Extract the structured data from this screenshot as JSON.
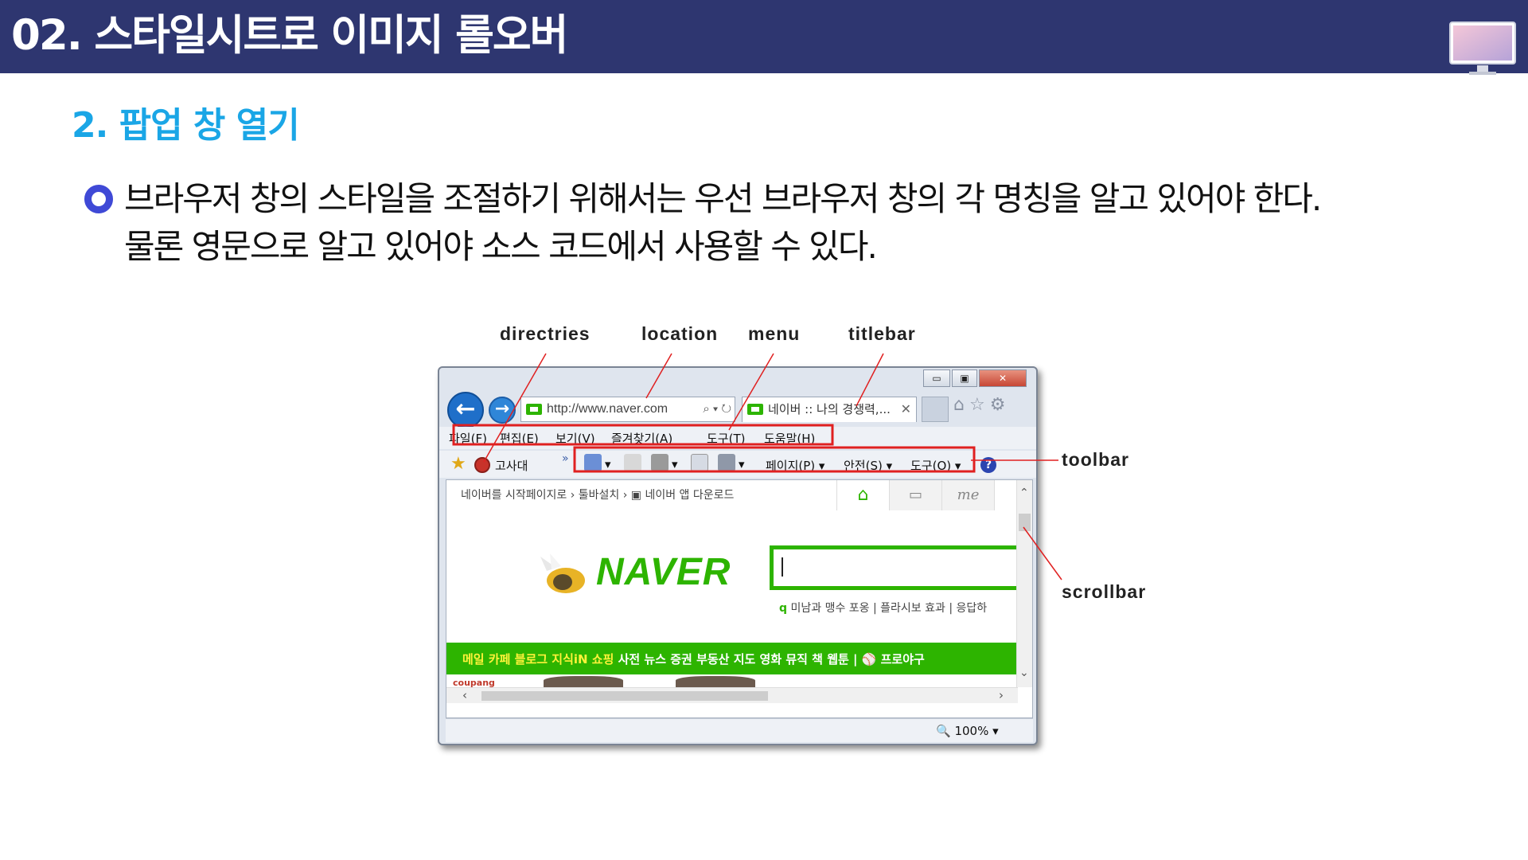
{
  "header": {
    "title": "02. 스타일시트로 이미지 롤오버",
    "icon": "monitor-icon",
    "background": "#2e3670"
  },
  "section": {
    "title": "2. 팝업 창 열기",
    "color": "#1aa6e6"
  },
  "body_text": {
    "bullet_icon": "ring-bullet-icon",
    "bullet_color": "#3f49d6",
    "line1": "브라우저 창의 스타일을 조절하기 위해서는 우선 브라우저 창의 각 명칭을 알고 있어야 한다.",
    "line2": "물론 영문으로 알고 있어야 소스 코드에서 사용할 수 있다."
  },
  "labels": {
    "directries": "directries",
    "location": "location",
    "menu": "menu",
    "titlebar": "titlebar",
    "toolbar": "toolbar",
    "scrollbar": "scrollbar",
    "highlight_color": "#e02020"
  },
  "browser": {
    "window_buttons": {
      "minimize": "▭",
      "maximize": "▣",
      "close": "✕"
    },
    "address": "http://www.naver.com",
    "address_tools": "⌕ ▾ ↻",
    "tab_title": "네이버 :: 나의 경쟁력,...",
    "tab_close": "✕",
    "chrome_icons": "⌂☆⚙",
    "menu_items": [
      "파일(F)",
      "편집(E)",
      "보기(V)",
      "즐겨찾기(A)",
      "도구(T)",
      "도움말(H)"
    ],
    "favorites": {
      "label": "고사대",
      "overflow": "»"
    },
    "toolbar_items": {
      "page": "페이지(P) ▾",
      "safety": "안전(S) ▾",
      "tools": "도구(O) ▾",
      "help": "?"
    },
    "page": {
      "links": "네이버를 시작페이지로 ›   툴바설치 ›   ▣ 네이버 앱 다운로드",
      "tab_home": "⌂",
      "tab_mail": "▭",
      "tab_me": "me",
      "logo": "NAVER",
      "keywords": "미남과 맹수 포옹   |   플라시보 효과   |   응답하",
      "keyword_icon": "q",
      "nav_yellow": "메일  카페  블로그  지식iN  쇼핑",
      "nav_white": "  사전  뉴스  증권  부동산  지도  영화  뮤직  책  웹툰  |  ⚾ 프로야구",
      "ad": "coupang",
      "scroll_up": "⌃",
      "scroll_down": "⌄",
      "scroll_left": "‹",
      "scroll_right": "›"
    },
    "zoom": "🔍 100%   ▾"
  }
}
